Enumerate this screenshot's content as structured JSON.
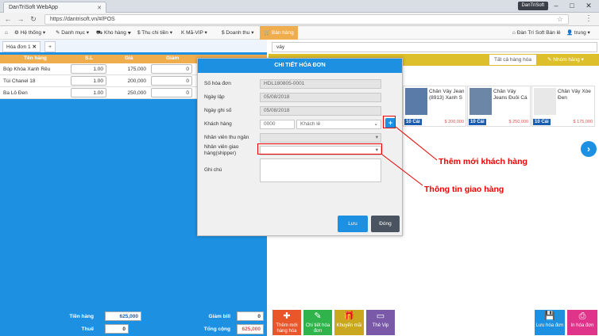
{
  "browser": {
    "tab_title": "DanTriSoft WebApp",
    "profile": "DanTriSoft",
    "url": "https://dantrisoft.vn/#/POS"
  },
  "nav": {
    "items": [
      "Hệ thống ▾",
      "Danh mục ▾",
      "Kho hàng ▾",
      "$ Thu chi tiền ▾",
      "K Mã-VIP ▾",
      "$ Doanh thu ▾",
      "Bán hàng"
    ],
    "store": "Đàn Trí Soft Bán lẻ",
    "user": "trung ▾"
  },
  "invoice_tabs": {
    "current": "Hóa đơn 1",
    "add": "+"
  },
  "grid": {
    "headers": [
      "Tên hàng",
      "S.L",
      "Giá",
      "Giảm"
    ],
    "rows": [
      {
        "name": "Bóp Khóa Xanh Rêu",
        "qty": "1.00",
        "price": "175,000",
        "disc": "0"
      },
      {
        "name": "Túi Chanel 18",
        "qty": "1.00",
        "price": "200,000",
        "disc": "0"
      },
      {
        "name": "Ba Lô Đen",
        "qty": "1.00",
        "price": "250,000",
        "disc": "0"
      }
    ]
  },
  "totals": {
    "tien_hang_label": "Tiền hàng",
    "tien_hang": "625,000",
    "thue_label": "Thuế",
    "thue": "0",
    "giam_bill_label": "Giảm bill",
    "giam_bill": "0",
    "tong_cong_label": "Tổng cộng",
    "tong_cong": "625,000"
  },
  "search": {
    "value": "váy"
  },
  "categories": {
    "all": "Tất cả hàng hóa",
    "group": "Nhóm hàng ▾"
  },
  "products": [
    {
      "name": "Chân Váy Jean (8913) Xanh S",
      "stock": "10 Cái",
      "price": "$ 200,000"
    },
    {
      "name": "Chân Váy Jeans Đuôi Cá",
      "stock": "10 Cái",
      "price": "$ 250,000"
    },
    {
      "name": "Chân Váy Xòe Đen",
      "stock": "10 Cái",
      "price": "$ 175,000"
    }
  ],
  "dialog": {
    "title": "CHI TIẾT HÓA ĐƠN",
    "so_hoa_don_label": "Số hóa đơn",
    "so_hoa_don": "HDL180805-0001",
    "ngay_lap_label": "Ngày lập",
    "ngay_lap": "05/08/2018",
    "ngay_ghi_so_label": "Ngày ghi số",
    "ngay_ghi_so": "05/08/2018",
    "khach_hang_label": "Khách hàng",
    "khach_hang_code": "0000",
    "khach_hang_name": "Khách lẻ",
    "nhan_vien_thu_ngan_label": "Nhân viên thu ngân",
    "nhan_vien_giao_hang_label": "Nhân viên giao hàng(shipper)",
    "ghi_chu_label": "Ghi chú",
    "save_label": "Lưu",
    "close_label": "Đóng"
  },
  "bottom_buttons": {
    "new_item": "Thêm mới hàng hóa",
    "invoice_detail": "Chi tiết hóa đơn",
    "promo": "Khuyến mãi",
    "vip": "Thẻ Vip",
    "save_invoice": "Lưu hóa đơn",
    "print_invoice": "In hóa đơn"
  },
  "annotations": {
    "add_customer": "Thêm mới khách hàng",
    "shipping_info": "Thông tin giao hàng"
  },
  "colors": {
    "primary": "#1d90e2",
    "accent": "#f0ad4e",
    "callout": "#e00000"
  }
}
